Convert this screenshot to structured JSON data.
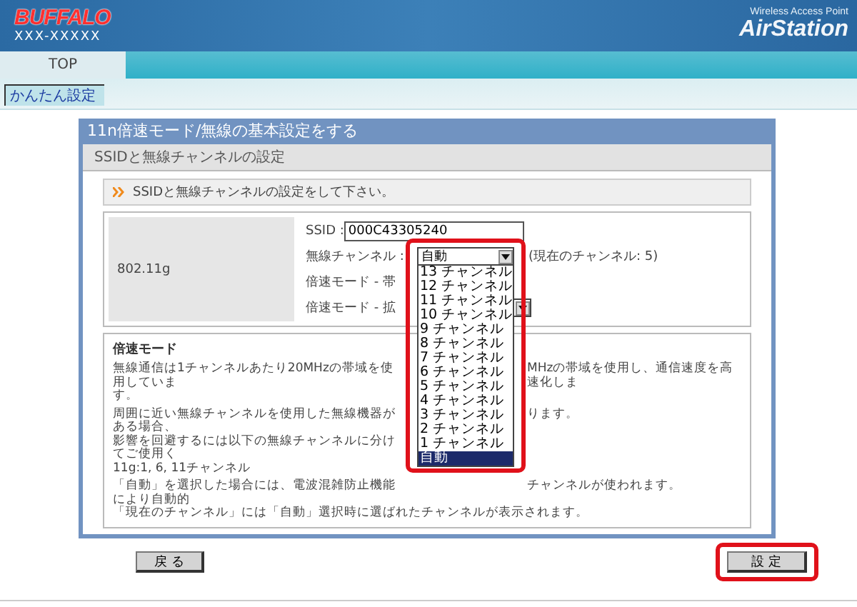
{
  "header": {
    "brand": "BUFFALO",
    "model": "XXX-XXXXX",
    "product_caption": "Wireless Access Point",
    "product": "AirStation"
  },
  "tabs": [
    {
      "label": "TOP",
      "selected": true
    }
  ],
  "subnav": {
    "link": "かんたん設定"
  },
  "panel": {
    "title": "11n倍速モード/無線の基本設定をする",
    "subtitle": "SSIDと無線チャンネルの設定",
    "instruction": "SSIDと無線チャンネルの設定をして下さい。",
    "band": "802.11g",
    "ssid": {
      "label": "SSID :",
      "value": "000C43305240"
    },
    "channel": {
      "label": "無線チャンネル :",
      "value": "自動",
      "current": "(現在のチャンネル: 5)",
      "options": [
        {
          "label": "13 チャンネル",
          "selected": false
        },
        {
          "label": "12 チャンネル",
          "selected": false
        },
        {
          "label": "11 チャンネル",
          "selected": false
        },
        {
          "label": "10 チャンネル",
          "selected": false
        },
        {
          "label": "9 チャンネル",
          "selected": false
        },
        {
          "label": "8 チャンネル",
          "selected": false
        },
        {
          "label": "7 チャンネル",
          "selected": false
        },
        {
          "label": "6 チャンネル",
          "selected": false
        },
        {
          "label": "5 チャンネル",
          "selected": false
        },
        {
          "label": "4 チャンネル",
          "selected": false
        },
        {
          "label": "3 チャンネル",
          "selected": false
        },
        {
          "label": "2 チャンネル",
          "selected": false
        },
        {
          "label": "1 チャンネル",
          "selected": false
        },
        {
          "label": "自動",
          "selected": true
        }
      ]
    },
    "speed_rows": [
      {
        "label": "倍速モード - 帯",
        "kind": "label"
      },
      {
        "label": "倍速モード - 拡",
        "kind": "select"
      }
    ],
    "description": {
      "heading": "倍速モード",
      "paragraphs": [
        [
          {
            "kind": "split",
            "left": "無線通信は1チャンネルあたり20MHzの帯域を使用していま",
            "right": "MHzの帯域を使用し、通信速度を高速化しま"
          },
          {
            "kind": "left",
            "left": "す。"
          }
        ],
        [
          {
            "kind": "split",
            "left": "周囲に近い無線チャンネルを使用した無線機器がある場合、",
            "right": "ります。"
          },
          {
            "kind": "left",
            "left": "影響を回避するには以下の無線チャンネルに分けてご使用く"
          },
          {
            "kind": "left",
            "left": "11g:1, 6, 11チャンネル"
          }
        ],
        [
          {
            "kind": "split",
            "left": "「自動」を選択した場合には、電波混雑防止機能により自動的",
            "right": "チャンネルが使われます。"
          },
          {
            "kind": "full",
            "left": "「現在のチャンネル」には「自動」選択時に選ばれたチャンネルが表示されます。"
          }
        ]
      ]
    }
  },
  "buttons": [
    {
      "label": "戻 る",
      "highlighted": false
    },
    {
      "label": "設 定",
      "highlighted": true
    }
  ]
}
